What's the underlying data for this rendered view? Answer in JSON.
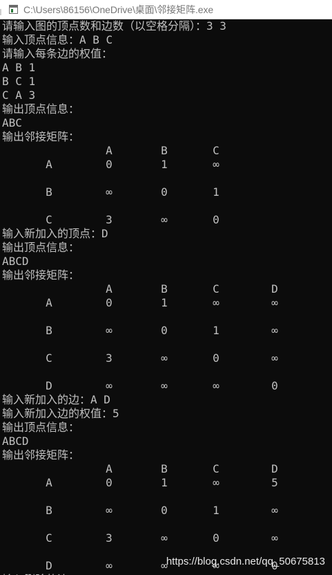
{
  "window": {
    "title": "C:\\Users\\86156\\OneDrive\\桌面\\邻接矩阵.exe",
    "app_icon": "console-app-icon"
  },
  "console": {
    "intro": [
      "请输入图的顶点数和边数（以空格分隔）：3 3",
      "输入顶点信息：A B C",
      "请输入每条边的权值：",
      "A B 1",
      "B C 1",
      "C A 3",
      "输出顶点信息：",
      "ABC",
      "输出邻接矩阵："
    ],
    "matrix1": {
      "headers": [
        "A",
        "B",
        "C"
      ],
      "rows": [
        {
          "label": "A",
          "cells": [
            "0",
            "1",
            "∞"
          ]
        },
        {
          "label": "B",
          "cells": [
            "∞",
            "0",
            "1"
          ]
        },
        {
          "label": "C",
          "cells": [
            "3",
            "∞",
            "0"
          ]
        }
      ]
    },
    "section2": [
      "输入新加入的顶点：D",
      "输出顶点信息：",
      "ABCD",
      "输出邻接矩阵："
    ],
    "matrix2": {
      "headers": [
        "A",
        "B",
        "C",
        "D"
      ],
      "rows": [
        {
          "label": "A",
          "cells": [
            "0",
            "1",
            "∞",
            "∞"
          ]
        },
        {
          "label": "B",
          "cells": [
            "∞",
            "0",
            "1",
            "∞"
          ]
        },
        {
          "label": "C",
          "cells": [
            "3",
            "∞",
            "0",
            "∞"
          ]
        },
        {
          "label": "D",
          "cells": [
            "∞",
            "∞",
            "∞",
            "0"
          ]
        }
      ]
    },
    "section3": [
      "输入新加入的边：A D",
      "输入新加入边的权值：5",
      "输出顶点信息：",
      "ABCD",
      "输出邻接矩阵："
    ],
    "matrix3": {
      "headers": [
        "A",
        "B",
        "C",
        "D"
      ],
      "rows": [
        {
          "label": "A",
          "cells": [
            "0",
            "1",
            "∞",
            "5"
          ]
        },
        {
          "label": "B",
          "cells": [
            "∞",
            "0",
            "1",
            "∞"
          ]
        },
        {
          "label": "C",
          "cells": [
            "3",
            "∞",
            "0",
            "∞"
          ]
        },
        {
          "label": "D",
          "cells": [
            "∞",
            "∞",
            "∞",
            "0"
          ]
        }
      ]
    },
    "last_line": "输入删除的边："
  },
  "watermark": "https://blog.csdn.net/qq_50675813"
}
